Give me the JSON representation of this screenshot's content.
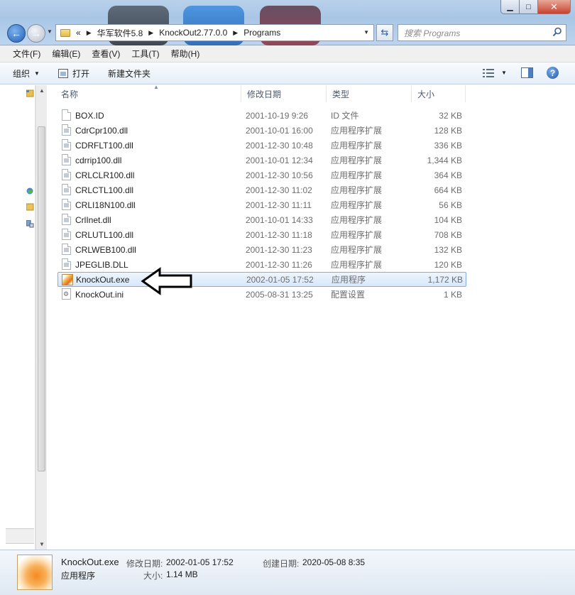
{
  "window": {
    "min_label": "▁",
    "max_label": "□",
    "close_label": "✕"
  },
  "address": {
    "prefix": "«",
    "crumbs": [
      "华军软件5.8",
      "KnockOut2.77.0.0",
      "Programs"
    ]
  },
  "search": {
    "placeholder": "搜索 Programs"
  },
  "menu": [
    "文件(F)",
    "编辑(E)",
    "查看(V)",
    "工具(T)",
    "帮助(H)"
  ],
  "toolbar": {
    "organize": "组织",
    "open": "打开",
    "new_folder": "新建文件夹",
    "help": "?"
  },
  "columns": {
    "name": "名称",
    "date": "修改日期",
    "type": "类型",
    "size": "大小"
  },
  "files": [
    {
      "name": "BOX.ID",
      "date": "2001-10-19 9:26",
      "type": "ID 文件",
      "size": "32 KB",
      "icon": "file-icon"
    },
    {
      "name": "CdrCpr100.dll",
      "date": "2001-10-01 16:00",
      "type": "应用程序扩展",
      "size": "128 KB",
      "icon": "dll-icon"
    },
    {
      "name": "CDRFLT100.dll",
      "date": "2001-12-30 10:48",
      "type": "应用程序扩展",
      "size": "336 KB",
      "icon": "dll-icon"
    },
    {
      "name": "cdrrip100.dll",
      "date": "2001-10-01 12:34",
      "type": "应用程序扩展",
      "size": "1,344 KB",
      "icon": "dll-icon"
    },
    {
      "name": "CRLCLR100.dll",
      "date": "2001-12-30 10:56",
      "type": "应用程序扩展",
      "size": "364 KB",
      "icon": "dll-icon"
    },
    {
      "name": "CRLCTL100.dll",
      "date": "2001-12-30 11:02",
      "type": "应用程序扩展",
      "size": "664 KB",
      "icon": "dll-icon"
    },
    {
      "name": "CRLI18N100.dll",
      "date": "2001-12-30 11:11",
      "type": "应用程序扩展",
      "size": "56 KB",
      "icon": "dll-icon"
    },
    {
      "name": "CrlInet.dll",
      "date": "2001-10-01 14:33",
      "type": "应用程序扩展",
      "size": "104 KB",
      "icon": "dll-icon"
    },
    {
      "name": "CRLUTL100.dll",
      "date": "2001-12-30 11:18",
      "type": "应用程序扩展",
      "size": "708 KB",
      "icon": "dll-icon"
    },
    {
      "name": "CRLWEB100.dll",
      "date": "2001-12-30 11:23",
      "type": "应用程序扩展",
      "size": "132 KB",
      "icon": "dll-icon"
    },
    {
      "name": "JPEGLIB.DLL",
      "date": "2001-12-30 11:26",
      "type": "应用程序扩展",
      "size": "120 KB",
      "icon": "dll-icon"
    },
    {
      "name": "KnockOut.exe",
      "date": "2002-01-05 17:52",
      "type": "应用程序",
      "size": "1,172 KB",
      "icon": "exe-icon",
      "selected": true
    },
    {
      "name": "KnockOut.ini",
      "date": "2005-08-31 13:25",
      "type": "配置设置",
      "size": "1 KB",
      "icon": "ini-icon"
    }
  ],
  "details": {
    "name": "KnockOut.exe",
    "kind": "应用程序",
    "modified_label": "修改日期:",
    "modified_value": "2002-01-05 17:52",
    "created_label": "创建日期:",
    "created_value": "2020-05-08 8:35",
    "size_label": "大小:",
    "size_value": "1.14 MB"
  }
}
